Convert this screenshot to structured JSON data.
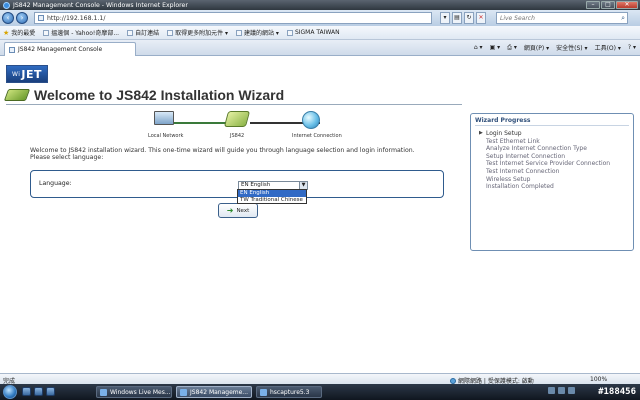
{
  "window": {
    "title": "JS842 Management Console - Windows Internet Explorer"
  },
  "address_bar": {
    "url": "http://192.168.1.1/",
    "search_placeholder": "Live Search"
  },
  "favorites_bar": {
    "items": [
      "我的最愛",
      "搵邊個 - Yahoo!奇摩部...",
      "自訂連結",
      "取得更多附加元件 ▾",
      "建議的網站 ▾",
      "SIGMA TAIWAN"
    ]
  },
  "tab": {
    "title": "JS842 Management Console"
  },
  "command_bar": {
    "page": "網頁(P) ▾",
    "safety": "安全性(S) ▾",
    "tools": "工具(O) ▾"
  },
  "page": {
    "logo": {
      "prefix": "Wi",
      "main": "JET"
    },
    "title": "Welcome to JS842 Installation Wizard",
    "diagram_labels": [
      "Local Network",
      "JS842",
      "Internet Connection"
    ],
    "intro_line1": "Welcome to JS842 installation wizard. This one-time wizard will guide you through language selection and login information.",
    "intro_line2": "Please select language:",
    "language_label": "Language:",
    "language_selected": "EN English",
    "language_options": [
      "EN English",
      "TW Traditional Chinese"
    ],
    "next_label": "Next"
  },
  "wizard_progress": {
    "title": "Wizard Progress",
    "steps": [
      "Login Setup",
      "Test Ethernet Link",
      "Analyze Internet Connection Type",
      "Setup Internet Connection",
      "Test Internet Service Provider Connection",
      "Test Internet Connection",
      "Wireless Setup",
      "Installation Completed"
    ]
  },
  "status_bar": {
    "status": "完成",
    "zone": "網際網路 | 受保護模式: 啟動",
    "zoom": "100%"
  },
  "taskbar": {
    "tasks": [
      "Windows Live Mes...",
      "JS842 Manageme...",
      "hscapture5.3"
    ]
  },
  "watermark": "#188456"
}
